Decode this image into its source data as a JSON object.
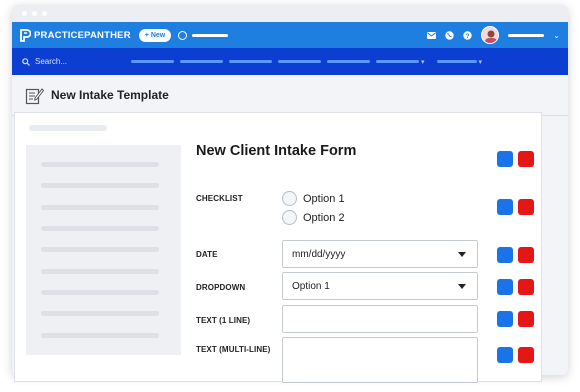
{
  "app": {
    "brand": "PRACTICEPANTHER",
    "new_button": "+ New"
  },
  "search": {
    "placeholder": "Search..."
  },
  "page": {
    "title": "New Intake Template"
  },
  "form": {
    "title": "New Client Intake Form",
    "fields": {
      "checklist": {
        "label": "CHECKLIST",
        "options": [
          "Option 1",
          "Option 2"
        ]
      },
      "date": {
        "label": "DATE",
        "value": "mm/dd/yyyy"
      },
      "dropdown": {
        "label": "DROPDOWN",
        "value": "Option 1"
      },
      "text_single": {
        "label": "TEXT (1 LINE)",
        "value": ""
      },
      "text_multi": {
        "label": "TEXT (MULTI-LINE)",
        "value": ""
      }
    }
  },
  "colors": {
    "top_nav": "#1e7fe0",
    "sub_nav": "#0c3fd1",
    "action_blue": "#1a73e8",
    "action_red": "#e51616"
  },
  "icons": [
    "logo-icon",
    "timer-icon",
    "mail-icon",
    "globe-icon",
    "help-icon",
    "search-icon",
    "edit-form-icon",
    "chevron-down-icon"
  ]
}
